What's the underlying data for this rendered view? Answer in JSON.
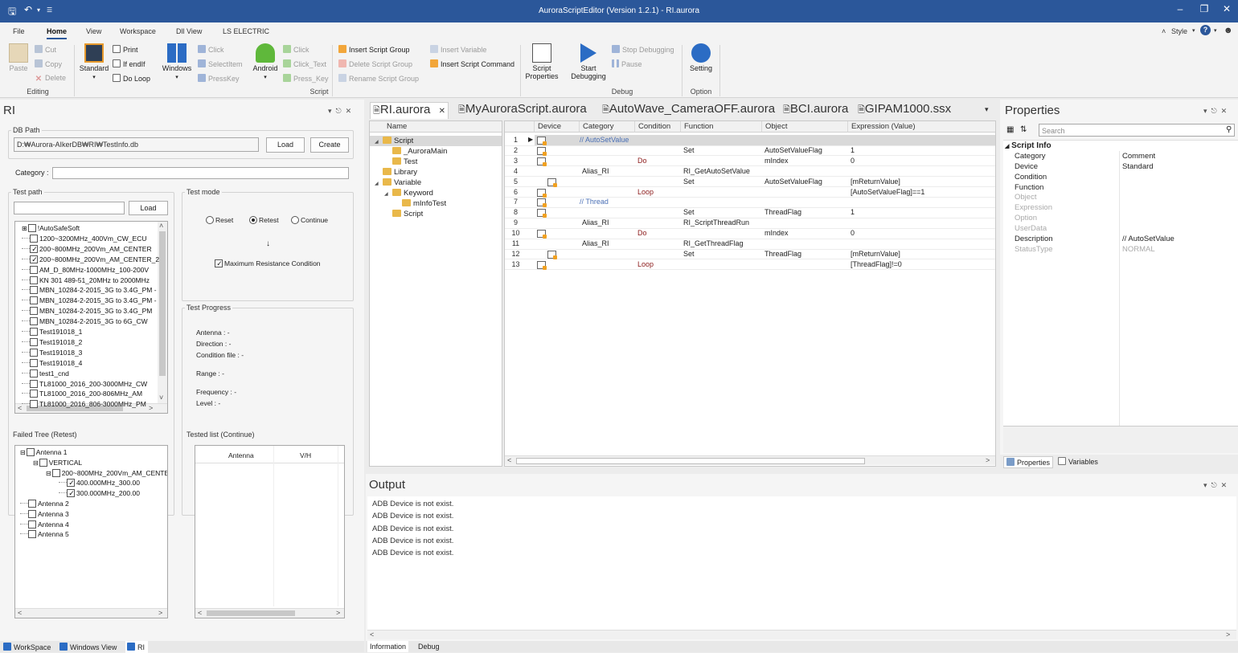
{
  "titlebar": {
    "title": "AuroraScriptEditor  (Version 1.2.1) - RI.aurora"
  },
  "menu": {
    "tabs": [
      "File",
      "Home",
      "View",
      "Workspace",
      "Dll View",
      "LS ELECTRIC"
    ],
    "style_label": "Style"
  },
  "ribbon": {
    "paste": "Paste",
    "cut": "Cut",
    "copy": "Copy",
    "delete": "Delete",
    "editing": "Editing",
    "standard": "Standard",
    "print": "Print",
    "ifendif": "If endIf",
    "doloop": "Do Loop",
    "windows": "Windows",
    "click": "Click",
    "selectitem": "SelectItem",
    "presskey": "PressKey",
    "android": "Android",
    "aclick": "Click",
    "aclicktext": "Click_Text",
    "apresskey": "Press_Key",
    "insert_group": "Insert Script Group",
    "delete_group": "Delete Script Group",
    "rename_group": "Rename Script Group",
    "insert_variable": "Insert Variable",
    "insert_command": "Insert Script Command",
    "script_group": "Script",
    "script_props": "Script\nProperties",
    "start_debug": "Start\nDebugging",
    "stop_debug": "Stop Debugging",
    "pause": "Pause",
    "debug": "Debug",
    "setting": "Setting",
    "option": "Option"
  },
  "ri": {
    "title": "RI",
    "dbpath_label": "DB Path",
    "dbpath_value": "D:₩Aurora-AIkerDB₩RI₩TestInfo.db",
    "load": "Load",
    "create": "Create",
    "category_label": "Category :",
    "testpath_label": "Test path",
    "testpath_load": "Load",
    "testpath_items": [
      {
        "label": "!AutoSafeSoft",
        "checked": false,
        "expander": true
      },
      {
        "label": "1200~3200MHz_400Vm_CW_ECU",
        "checked": false
      },
      {
        "label": "200~800MHz_200Vm_AM_CENTER",
        "checked": true
      },
      {
        "label": "200~800MHz_200Vm_AM_CENTER_2",
        "checked": true
      },
      {
        "label": "AM_D_80MHz-1000MHz_100-200V",
        "checked": false
      },
      {
        "label": "KN 301 489-51_20MHz to 2000MHz",
        "checked": false
      },
      {
        "label": "MBN_10284-2-2015_3G to 3.4G_PM -",
        "checked": false
      },
      {
        "label": "MBN_10284-2-2015_3G to 3.4G_PM -",
        "checked": false
      },
      {
        "label": "MBN_10284-2-2015_3G to 3.4G_PM",
        "checked": false
      },
      {
        "label": "MBN_10284-2-2015_3G to 6G_CW",
        "checked": false
      },
      {
        "label": "Test191018_1",
        "checked": false
      },
      {
        "label": "Test191018_2",
        "checked": false
      },
      {
        "label": "Test191018_3",
        "checked": false
      },
      {
        "label": "Test191018_4",
        "checked": false
      },
      {
        "label": "test1_cnd",
        "checked": false
      },
      {
        "label": "TL81000_2016_200-3000MHz_CW",
        "checked": false
      },
      {
        "label": "TL81000_2016_200-806MHz_AM",
        "checked": false
      },
      {
        "label": "TL81000_2016_806-3000MHz_PM",
        "checked": false
      }
    ],
    "testmode_label": "Test mode",
    "mode_reset": "Reset",
    "mode_retest": "Retest",
    "mode_continue": "Continue",
    "arrow": "↓",
    "max_resistance": "Maximum Resistance Condition",
    "progress_label": "Test Progress",
    "progress": {
      "antenna": "Antenna : -",
      "direction": "Direction : -",
      "condition": "Condition file : -",
      "range": "Range : -",
      "frequency": "Frequency : -",
      "level": "Level : -"
    },
    "failed_label": "Failed Tree (Retest)",
    "failed_items": [
      {
        "label": "Antenna 1",
        "checked": false,
        "indent": 0,
        "expander": true
      },
      {
        "label": "VERTICAL",
        "checked": false,
        "indent": 1,
        "expander": true
      },
      {
        "label": "200~800MHz_200Vm_AM_CENTE",
        "checked": false,
        "indent": 2,
        "expander": true
      },
      {
        "label": "400.000MHz_300.00",
        "checked": true,
        "indent": 3
      },
      {
        "label": "300.000MHz_200.00",
        "checked": true,
        "indent": 3
      },
      {
        "label": "Antenna 2",
        "checked": false,
        "indent": 0
      },
      {
        "label": "Antenna 3",
        "checked": false,
        "indent": 0
      },
      {
        "label": "Antenna 4",
        "checked": false,
        "indent": 0
      },
      {
        "label": "Antenna 5",
        "checked": false,
        "indent": 0
      }
    ],
    "tested_label": "Tested list (Continue)",
    "tested_cols": [
      "Antenna",
      "V/H"
    ]
  },
  "doctabs": [
    "RI.aurora",
    "MyAuroraScript.aurora",
    "AutoWave_CameraOFF.aurora",
    "BCI.aurora",
    "GIPAM1000.ssx"
  ],
  "tree": {
    "header": "Name",
    "items": [
      {
        "label": "Script",
        "indent": 0,
        "expander": "◢",
        "selected": true
      },
      {
        "label": "_AuroraMain",
        "indent": 1
      },
      {
        "label": "Test",
        "indent": 1
      },
      {
        "label": "Library",
        "indent": 0
      },
      {
        "label": "Variable",
        "indent": 0,
        "expander": "◢"
      },
      {
        "label": "Keyword",
        "indent": 1,
        "expander": "◢"
      },
      {
        "label": "mInfoTest",
        "indent": 2
      },
      {
        "label": "Script",
        "indent": 1
      }
    ]
  },
  "grid": {
    "columns": [
      "Device",
      "Category",
      "Condition",
      "Function",
      "Object",
      "Expression (Value)"
    ],
    "rows": [
      {
        "n": "1",
        "device": "",
        "category": "// AutoSetValue",
        "condition": "",
        "function": "",
        "object": "",
        "expr": "",
        "comment": true,
        "selected": true,
        "indent": 0
      },
      {
        "n": "2",
        "device": "",
        "category": "",
        "condition": "",
        "function": "Set",
        "object": "AutoSetValueFlag",
        "expr": "1",
        "indent": 0
      },
      {
        "n": "3",
        "device": "",
        "category": "",
        "condition": "Do",
        "function": "",
        "object": "mIndex",
        "expr": "0",
        "indent": 0
      },
      {
        "n": "4",
        "device": "Alias_RI",
        "category": "",
        "condition": "",
        "function": "RI_GetAutoSetValue",
        "object": "",
        "expr": "",
        "indent": 1,
        "noicon": true
      },
      {
        "n": "5",
        "device": "",
        "category": "",
        "condition": "",
        "function": "Set",
        "object": "AutoSetValueFlag",
        "expr": "[mReturnValue]",
        "indent": 1
      },
      {
        "n": "6",
        "device": "",
        "category": "",
        "condition": "Loop",
        "function": "",
        "object": "",
        "expr": "[AutoSetValueFlag]==1",
        "indent": 0
      },
      {
        "n": "7",
        "device": "",
        "category": "// Thread",
        "condition": "",
        "function": "",
        "object": "",
        "expr": "",
        "comment": true,
        "indent": 0
      },
      {
        "n": "8",
        "device": "",
        "category": "",
        "condition": "",
        "function": "Set",
        "object": "ThreadFlag",
        "expr": "1",
        "indent": 0
      },
      {
        "n": "9",
        "device": "Alias_RI",
        "category": "",
        "condition": "",
        "function": "RI_ScriptThreadRun",
        "object": "",
        "expr": "",
        "indent": 0,
        "noicon": true
      },
      {
        "n": "10",
        "device": "",
        "category": "",
        "condition": "Do",
        "function": "",
        "object": "mIndex",
        "expr": "0",
        "indent": 0
      },
      {
        "n": "11",
        "device": "Alias_RI",
        "category": "",
        "condition": "",
        "function": "RI_GetThreadFlag",
        "object": "",
        "expr": "",
        "indent": 1,
        "noicon": true
      },
      {
        "n": "12",
        "device": "",
        "category": "",
        "condition": "",
        "function": "Set",
        "object": "ThreadFlag",
        "expr": "[mReturnValue]",
        "indent": 1
      },
      {
        "n": "13",
        "device": "",
        "category": "",
        "condition": "Loop",
        "function": "",
        "object": "",
        "expr": "[ThreadFlag]!=0",
        "indent": 0
      }
    ]
  },
  "properties": {
    "title": "Properties",
    "search_placeholder": "Search",
    "section": "Script Info",
    "rows": [
      {
        "k": "Category",
        "v": "Comment"
      },
      {
        "k": "Device",
        "v": "Standard"
      },
      {
        "k": "Condition",
        "v": ""
      },
      {
        "k": "Function",
        "v": ""
      },
      {
        "k": "Object",
        "v": "",
        "dis": true
      },
      {
        "k": "Expression",
        "v": "",
        "dis": true
      },
      {
        "k": "Option",
        "v": "",
        "dis": true
      },
      {
        "k": "UserData",
        "v": "",
        "dis": true
      },
      {
        "k": "Description",
        "v": "// AutoSetValue"
      },
      {
        "k": "StatusType",
        "v": "NORMAL",
        "dis": true
      }
    ],
    "tab_properties": "Properties",
    "tab_variables": "Variables"
  },
  "output": {
    "title": "Output",
    "lines": [
      "ADB Device is not exist.",
      "ADB Device is not exist.",
      "ADB Device is not exist.",
      "ADB Device is not exist.",
      "ADB Device is not exist."
    ],
    "tab_info": "Information",
    "tab_debug": "Debug"
  },
  "bottomtabs": [
    "WorkSpace",
    "Windows View",
    "RI"
  ],
  "colors": {
    "accent": "#2b579a",
    "condition": "#8b1a1a",
    "comment": "#4a6fb5"
  }
}
